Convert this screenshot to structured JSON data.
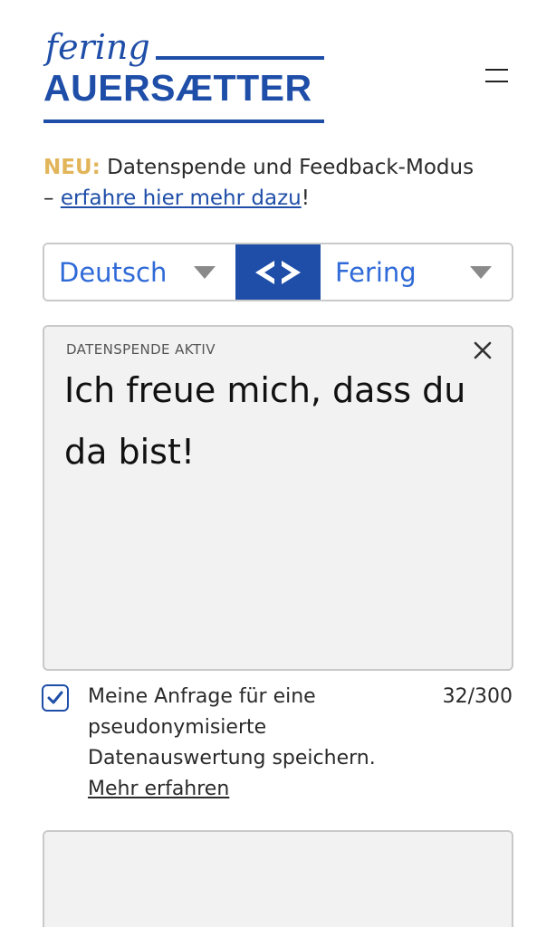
{
  "logo": {
    "fering": "fering",
    "wordmark": "AUERSÆTTER"
  },
  "announcement": {
    "badge": "NEU:",
    "text": " Datenspende und Feedback-Modus",
    "dash": "– ",
    "link": "erfahre hier mehr dazu",
    "suffix": "!"
  },
  "languages": {
    "source": "Deutsch",
    "target": "Fering"
  },
  "input": {
    "tag": "DATENSPENDE AKTIV",
    "text": "Ich freue mich, dass du da bist!"
  },
  "consent": {
    "checked": true,
    "text": "Meine Anfrage für eine pseudonymisierte Datenauswertung speichern.",
    "link": "Mehr erfahren",
    "counter": "32/300"
  },
  "icons": {
    "menu": "hamburger-icon",
    "swap": "swap-arrows-icon",
    "clear": "close-icon",
    "check": "checkmark-icon"
  },
  "colors": {
    "brand": "#1f4ea8",
    "accent": "#e2b55a",
    "link": "#2f6ad8"
  }
}
